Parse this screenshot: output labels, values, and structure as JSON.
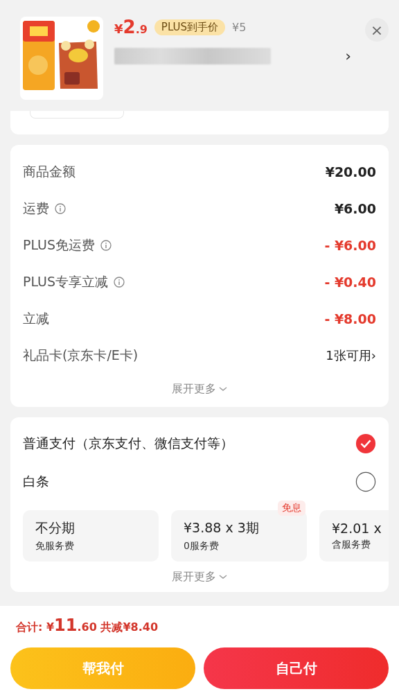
{
  "product": {
    "price_symbol": "¥",
    "price_int": "2",
    "price_dec": ".9",
    "badge": "PLUS到手价",
    "original_price": "¥5",
    "close": "×",
    "chevron": "›"
  },
  "fees": [
    {
      "label": "商品金额",
      "info": false,
      "kind": "normal",
      "value": "¥20.00"
    },
    {
      "label": "运费",
      "info": true,
      "kind": "normal",
      "value": "¥6.00"
    },
    {
      "label": "PLUS免运费",
      "info": true,
      "kind": "discount",
      "value": "- ¥6.00"
    },
    {
      "label": "PLUS专享立减",
      "info": true,
      "kind": "discount",
      "value": "- ¥0.40"
    },
    {
      "label": "立减",
      "info": false,
      "kind": "discount",
      "value": "- ¥8.00"
    },
    {
      "label": "礼品卡(京东卡/E卡)",
      "info": false,
      "kind": "link",
      "value": "1张可用",
      "chevron": "›"
    }
  ],
  "fees_more": "展开更多",
  "payments": [
    {
      "label": "普通支付（京东支付、微信支付等）",
      "selected": true
    },
    {
      "label": "白条",
      "selected": false
    }
  ],
  "installments": [
    {
      "title": "不分期",
      "sub": "免服务费"
    },
    {
      "title": "¥3.88 x 3期",
      "sub": "0服务费",
      "badge": "免息"
    },
    {
      "title": "¥2.01 x",
      "sub": "含服务费"
    }
  ],
  "payments_more": "展开更多",
  "footer": {
    "total_label": "合计:",
    "total_symbol": "¥",
    "total_int": "11",
    "total_dec": ".60",
    "saved": "共减¥8.40",
    "buttons": [
      {
        "label": "帮我付",
        "kind": "helper"
      },
      {
        "label": "自己付",
        "kind": "self"
      }
    ]
  }
}
